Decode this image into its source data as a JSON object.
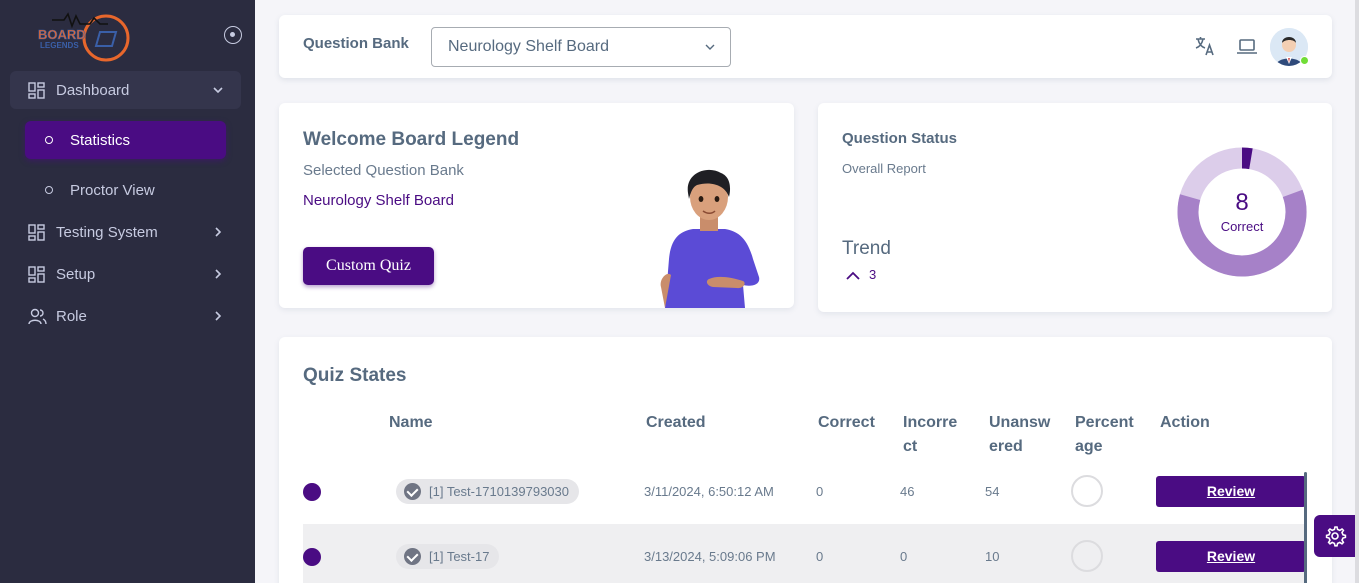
{
  "brand": {
    "logo_text": "BOARD",
    "logo_subtext": "LEGENDS"
  },
  "sidebar": {
    "items": [
      {
        "label": "Dashboard",
        "icon": "dashboard-icon",
        "expanded": true
      },
      {
        "label": "Testing System",
        "icon": "grid-icon"
      },
      {
        "label": "Setup",
        "icon": "grid-icon"
      },
      {
        "label": "Role",
        "icon": "users-icon"
      }
    ],
    "subitems": [
      {
        "label": "Statistics",
        "active": true
      },
      {
        "label": "Proctor View",
        "active": false
      }
    ]
  },
  "navbar": {
    "question_bank_label": "Question Bank",
    "question_bank_value": "Neurology Shelf Board"
  },
  "welcome": {
    "title": "Welcome Board Legend",
    "subtitle": "Selected Question Bank",
    "bank_name": "Neurology Shelf Board",
    "button_label": "Custom Quiz"
  },
  "status": {
    "title": "Question Status",
    "subtitle": "Overall Report",
    "trend_label": "Trend",
    "trend_value": "3",
    "donut_value": "8",
    "donut_label": "Correct"
  },
  "quiz": {
    "title": "Quiz States",
    "headers": {
      "name": "Name",
      "created": "Created",
      "correct": "Correct",
      "incorrect_1": "Incorre",
      "incorrect_2": "ct",
      "unanswered_1": "Unansw",
      "unanswered_2": "ered",
      "percentage_1": "Percent",
      "percentage_2": "age",
      "action": "Action"
    },
    "rows": [
      {
        "name": "[1] Test-1710139793030",
        "created": "3/11/2024, 6:50:12 AM",
        "correct": "0",
        "incorrect": "46",
        "unanswered": "54",
        "action": "Review"
      },
      {
        "name": "[1] Test-17",
        "created": "3/13/2024, 5:09:06 PM",
        "correct": "0",
        "incorrect": "0",
        "unanswered": "10",
        "action": "Review"
      }
    ]
  },
  "colors": {
    "primary": "#4a0c83",
    "sidebar_bg": "#2b2c40",
    "donut_main": "#a681c8",
    "donut_light": "#dccdea"
  }
}
